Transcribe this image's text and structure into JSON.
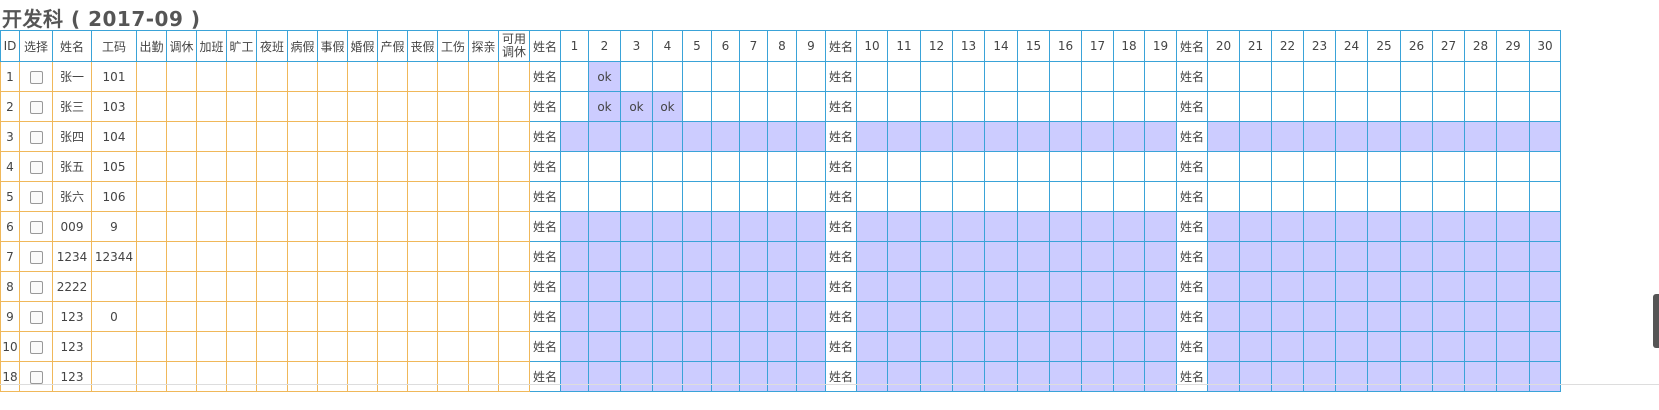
{
  "page_title": "开发科 ( 2017-09 )",
  "headers": {
    "left": [
      "ID",
      "选择",
      "姓名",
      "工码",
      "出勤",
      "调休",
      "加班",
      "旷工",
      "夜班",
      "病假",
      "事假",
      "婚假",
      "产假",
      "丧假",
      "工伤",
      "探亲",
      "可用调休"
    ],
    "name_col": "姓名",
    "block1": [
      "1",
      "2",
      "3",
      "4",
      "5",
      "6",
      "7",
      "8",
      "9"
    ],
    "block2": [
      "10",
      "11",
      "12",
      "13",
      "14",
      "15",
      "16",
      "17",
      "18",
      "19"
    ],
    "block3": [
      "20",
      "21",
      "22",
      "23",
      "24",
      "25",
      "26",
      "27",
      "28",
      "29",
      "30"
    ]
  },
  "rows": [
    {
      "id": "1",
      "name": "张一",
      "code": "101",
      "highlight": false,
      "ok_days": [
        "2"
      ]
    },
    {
      "id": "2",
      "name": "张三",
      "code": "103",
      "highlight": false,
      "ok_days": [
        "2",
        "3",
        "4"
      ]
    },
    {
      "id": "3",
      "name": "张四",
      "code": "104",
      "highlight": true,
      "ok_days": []
    },
    {
      "id": "4",
      "name": "张五",
      "code": "105",
      "highlight": false,
      "ok_days": []
    },
    {
      "id": "5",
      "name": "张六",
      "code": "106",
      "highlight": false,
      "ok_days": []
    },
    {
      "id": "6",
      "name": "009",
      "code": "9",
      "highlight": true,
      "ok_days": []
    },
    {
      "id": "7",
      "name": "1234",
      "code": "12344",
      "highlight": true,
      "ok_days": []
    },
    {
      "id": "8",
      "name": "2222",
      "code": "",
      "highlight": true,
      "ok_days": []
    },
    {
      "id": "9",
      "name": "123",
      "code": "0",
      "highlight": true,
      "ok_days": []
    },
    {
      "id": "10",
      "name": "123",
      "code": "",
      "highlight": true,
      "ok_days": []
    },
    {
      "id": "18",
      "name": "123",
      "code": "",
      "highlight": true,
      "ok_days": []
    }
  ],
  "cell_ok_text": "ok",
  "row_name_label": "姓名",
  "colors": {
    "orange_border": "#f0b85a",
    "blue_border": "#3aa3d8",
    "highlight": "#ccccff"
  }
}
